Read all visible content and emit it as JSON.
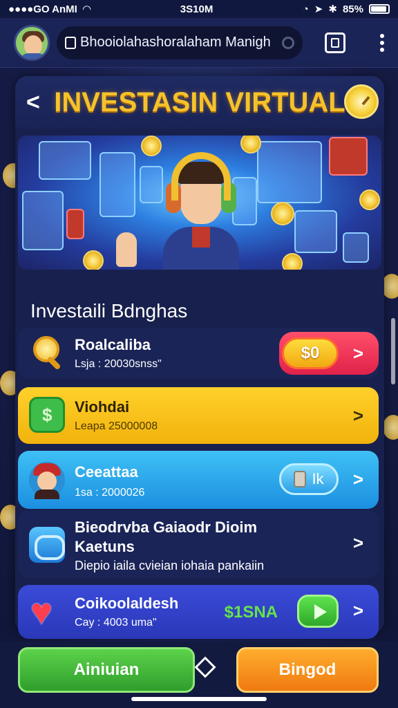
{
  "status_bar": {
    "carrier": "●●●●GO AnMI",
    "time": "3S10M",
    "battery": "85%"
  },
  "browser": {
    "url_text": "Bhooiolahashoralaham Manigh"
  },
  "header": {
    "back_label": "<",
    "title": "INVESTASIN VIRTUAL"
  },
  "section": {
    "title": "Investaili Bdnghas"
  },
  "rows": [
    {
      "name": "Roalcaliba",
      "sub": "Lsja : 20030snss\"",
      "badge": "$0",
      "chevron": ">"
    },
    {
      "name": "Viohdai",
      "sub": "Leapa  25000008",
      "chevron": ">"
    },
    {
      "name": "Ceeattaa",
      "sub": "1sa : 2000026",
      "badge": "Ik",
      "chevron": ">"
    },
    {
      "name": "Bieodrvba Gaiaodr Dioim",
      "name2": "Kaetuns",
      "sub": "Diepio iaila cvieian iohaia pankaiin",
      "chevron": ">"
    },
    {
      "name": "Coikoolaldesh",
      "sub": "Cay : 4003 uma\"",
      "amount": "$1SNA",
      "chevron": ">"
    }
  ],
  "bottom": {
    "left_button": "Ainiuian",
    "right_button": "Bingod"
  },
  "colors": {
    "title": "#f6c22b",
    "background": "#1a2152",
    "yellow_row": "#ffd12b",
    "blue_row": "#3ec0f5",
    "purple_row": "#3a4bd8",
    "green_button": "#2f9e2c",
    "orange_button": "#ef7a10"
  },
  "icons": {
    "row1": "magnifier-icon",
    "row2": "money-chat-icon",
    "row3": "person-icon",
    "row4": "coins-icon",
    "row5": "heart-icon"
  }
}
